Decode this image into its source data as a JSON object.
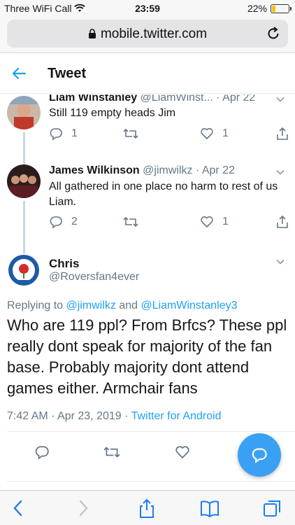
{
  "status_bar": {
    "carrier": "Three WiFi Call",
    "time": "23:59",
    "battery": "22%",
    "battery_level": 0.22
  },
  "browser": {
    "url": "mobile.twitter.com"
  },
  "header": {
    "title": "Tweet"
  },
  "replies": [
    {
      "name": "Liam Winstanley",
      "handle": "@LiamWinst...",
      "date": "· Apr 22",
      "text": "Still 119 empty heads Jim",
      "reply_count": "1",
      "like_count": "1"
    },
    {
      "name": "James Wilkinson",
      "handle": "@jimwilkz",
      "date": "· Apr 22",
      "text": "All gathered in one place no harm to rest of us Liam.",
      "reply_count": "2",
      "like_count": "1"
    }
  ],
  "focused_tweet": {
    "name": "Chris",
    "handle": "@Roversfan4ever",
    "replying_prefix": "Replying to",
    "mention_1": "@jimwilkz",
    "and": "and",
    "mention_2": "@LiamWinstanley3",
    "text": "Who are 119 ppl? From Brfcs? These ppl really dont speak for majority of the fan base. Probably majority dont attend games either. Armchair fans",
    "timestamp": "7:42 AM · Apr 23, 2019 ·",
    "source": "Twitter for Android"
  },
  "colors": {
    "accent": "#1da1f2",
    "fab": "#3aa0f3",
    "muted": "#657786",
    "ios_blue": "#1a7cf3"
  }
}
